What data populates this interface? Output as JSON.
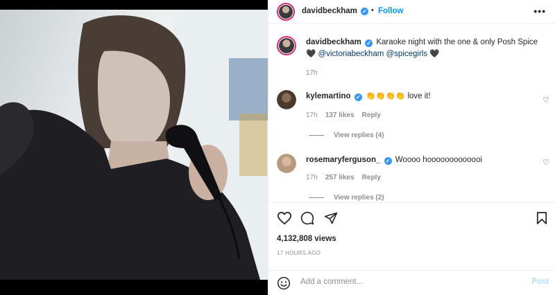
{
  "post": {
    "author": "davidbeckham",
    "follow_label": "Follow",
    "dot": "•",
    "more_label": "•••"
  },
  "caption": {
    "author": "davidbeckham",
    "text": "Karaoke night with the one & only Posh Spice",
    "heart1": "🖤",
    "mention1": "@victoriabeckham",
    "mention2": "@spicegirls",
    "heart2": "🖤",
    "time": "17h"
  },
  "comments": [
    {
      "username": "kylemartino",
      "text": "👏👏👏👏 love it!",
      "time": "17h",
      "likes": "137 likes",
      "reply": "Reply",
      "view_replies": "View replies (4)"
    },
    {
      "username": "rosemaryferguson_",
      "text": "Woooo hooooooooooooi",
      "time": "17h",
      "likes": "257 likes",
      "reply": "Reply",
      "view_replies": "View replies (2)"
    }
  ],
  "stats": {
    "views": "4,132,808 views",
    "time_ago": "17 HOURS AGO"
  },
  "add_comment": {
    "placeholder": "Add a comment...",
    "post_label": "Post"
  },
  "icons": {
    "like": "heart-outline-icon",
    "comment": "speech-bubble-icon",
    "share": "paper-plane-icon",
    "save": "bookmark-icon",
    "emoji": "smiley-icon",
    "verified": "verified-badge-icon"
  },
  "colors": {
    "accent": "#0095f6",
    "verified": "#3897f0",
    "muted": "#8e8e8e",
    "post_disabled": "#b2dffc"
  }
}
